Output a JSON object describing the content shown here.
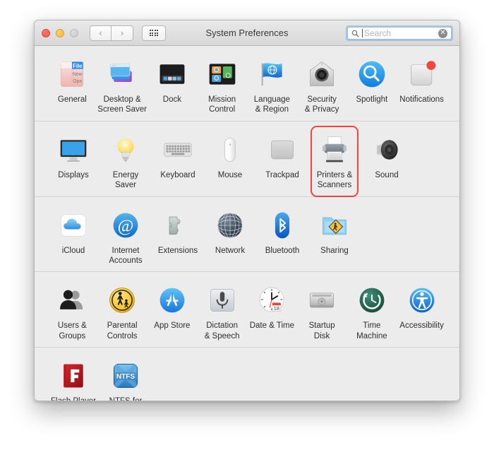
{
  "window": {
    "title": "System Preferences",
    "traffic_lights": [
      {
        "name": "close",
        "color": "#f4524a"
      },
      {
        "name": "minimize",
        "color": "#f2b63c"
      },
      {
        "name": "zoom",
        "color": "#c9c9c9"
      }
    ],
    "toolbar": {
      "back_label": "‹",
      "forward_label": "›",
      "grid_label": "show-all"
    },
    "search": {
      "placeholder": "Search",
      "value": "",
      "clear_label": "✕"
    }
  },
  "highlight": {
    "target": "Printers & Scanners",
    "color": "#f4453c"
  },
  "rows": [
    {
      "name": "personal",
      "items": [
        {
          "label": "General",
          "icon": "general-icon"
        },
        {
          "label": "Desktop &\nScreen Saver",
          "icon": "desktop-screensaver-icon"
        },
        {
          "label": "Dock",
          "icon": "dock-icon"
        },
        {
          "label": "Mission\nControl",
          "icon": "mission-control-icon"
        },
        {
          "label": "Language\n& Region",
          "icon": "language-region-icon"
        },
        {
          "label": "Security\n& Privacy",
          "icon": "security-privacy-icon"
        },
        {
          "label": "Spotlight",
          "icon": "spotlight-icon"
        },
        {
          "label": "Notifications",
          "icon": "notifications-icon"
        }
      ]
    },
    {
      "name": "hardware",
      "items": [
        {
          "label": "Displays",
          "icon": "displays-icon"
        },
        {
          "label": "Energy\nSaver",
          "icon": "energy-saver-icon"
        },
        {
          "label": "Keyboard",
          "icon": "keyboard-icon"
        },
        {
          "label": "Mouse",
          "icon": "mouse-icon"
        },
        {
          "label": "Trackpad",
          "icon": "trackpad-icon"
        },
        {
          "label": "Printers &\nScanners",
          "icon": "printers-scanners-icon",
          "highlighted": true
        },
        {
          "label": "Sound",
          "icon": "sound-icon"
        }
      ]
    },
    {
      "name": "internet-wireless",
      "items": [
        {
          "label": "iCloud",
          "icon": "icloud-icon"
        },
        {
          "label": "Internet\nAccounts",
          "icon": "internet-accounts-icon"
        },
        {
          "label": "Extensions",
          "icon": "extensions-icon"
        },
        {
          "label": "Network",
          "icon": "network-icon"
        },
        {
          "label": "Bluetooth",
          "icon": "bluetooth-icon"
        },
        {
          "label": "Sharing",
          "icon": "sharing-icon"
        }
      ]
    },
    {
      "name": "system",
      "items": [
        {
          "label": "Users &\nGroups",
          "icon": "users-groups-icon"
        },
        {
          "label": "Parental\nControls",
          "icon": "parental-controls-icon"
        },
        {
          "label": "App Store",
          "icon": "app-store-icon"
        },
        {
          "label": "Dictation\n& Speech",
          "icon": "dictation-speech-icon"
        },
        {
          "label": "Date & Time",
          "icon": "date-time-icon"
        },
        {
          "label": "Startup\nDisk",
          "icon": "startup-disk-icon"
        },
        {
          "label": "Time\nMachine",
          "icon": "time-machine-icon"
        },
        {
          "label": "Accessibility",
          "icon": "accessibility-icon"
        }
      ]
    },
    {
      "name": "other",
      "items": [
        {
          "label": "Flash Player",
          "icon": "flash-player-icon"
        },
        {
          "label": "NTFS for\nMac OS X",
          "icon": "ntfs-icon"
        }
      ]
    }
  ]
}
